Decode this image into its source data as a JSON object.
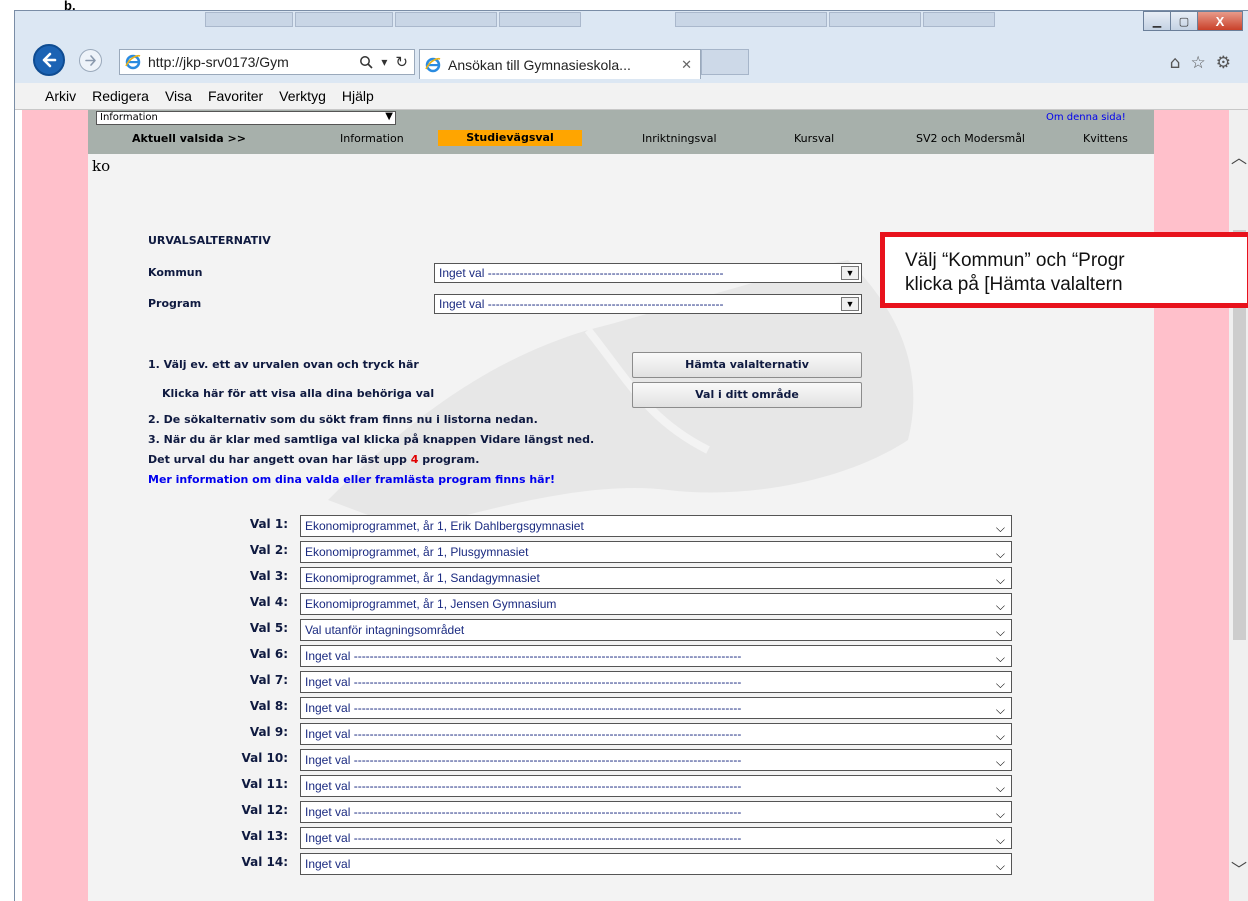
{
  "heading": {
    "text": "b."
  },
  "browser": {
    "address": "http://jkp-srv0173/Gym",
    "tab_title": "Ansökan till Gymnasieskola...",
    "tab_close": "✕",
    "window_buttons": {
      "minimize": "▁",
      "maximize": "▢",
      "close": "X"
    }
  },
  "menubar": [
    "Arkiv",
    "Redigera",
    "Visa",
    "Favoriter",
    "Verktyg",
    "Hjälp"
  ],
  "page": {
    "info_select": "Information",
    "about_link": "Om denna sida!",
    "steps": {
      "current_label": "Aktuell valsida >>",
      "information": "Information",
      "studievagsval": "Studievägsval",
      "inriktningsval": "Inriktningsval",
      "kursval": "Kursval",
      "sv2": "SV2 och Modersmål",
      "kvittens": "Kvittens"
    },
    "stray_text": "ko",
    "form": {
      "heading": "URVALSALTERNATIV",
      "kommun_label": "Kommun",
      "kommun_value": "Inget val -----------------------------------------------------------",
      "program_label": "Program",
      "program_value": "Inget val -----------------------------------------------------------"
    },
    "instructions": {
      "step1": "1. Välj ev. ett av urvalen ovan och tryck här",
      "show_all": "Klicka här för att visa alla dina behöriga val",
      "step2": "2. De sökalternativ som du sökt fram finns nu i listorna nedan.",
      "step3": "3. När du är klar med samtliga val klicka på knappen Vidare längst ned.",
      "result_prefix": "Det urval du har angett ovan har läst upp",
      "result_count": "4",
      "result_suffix": "program.",
      "more_info_link": "Mer information om dina valda eller framlästa program finns här!"
    },
    "buttons": {
      "fetch": "Hämta valalternativ",
      "area": "Val i ditt område"
    },
    "choices": [
      {
        "label": "Val 1:",
        "value": "Ekonomiprogrammet, år 1, Erik Dahlbergsgymnasiet"
      },
      {
        "label": "Val 2:",
        "value": "Ekonomiprogrammet, år 1, Plusgymnasiet"
      },
      {
        "label": "Val 3:",
        "value": "Ekonomiprogrammet, år 1, Sandagymnasiet"
      },
      {
        "label": "Val 4:",
        "value": "Ekonomiprogrammet, år 1, Jensen Gymnasium"
      },
      {
        "label": "Val 5:",
        "value": "Val utanför intagningsområdet"
      },
      {
        "label": "Val 6:",
        "value": "Inget val -------------------------------------------------------------------------------------------------"
      },
      {
        "label": "Val 7:",
        "value": "Inget val -------------------------------------------------------------------------------------------------"
      },
      {
        "label": "Val 8:",
        "value": "Inget val -------------------------------------------------------------------------------------------------"
      },
      {
        "label": "Val 9:",
        "value": "Inget val -------------------------------------------------------------------------------------------------"
      },
      {
        "label": "Val 10:",
        "value": "Inget val -------------------------------------------------------------------------------------------------"
      },
      {
        "label": "Val 11:",
        "value": "Inget val -------------------------------------------------------------------------------------------------"
      },
      {
        "label": "Val 12:",
        "value": "Inget val -------------------------------------------------------------------------------------------------"
      },
      {
        "label": "Val 13:",
        "value": "Inget val -------------------------------------------------------------------------------------------------"
      },
      {
        "label": "Val 14:",
        "value": "Inget val"
      }
    ]
  },
  "callout": {
    "line1": "Välj “Kommun” och “Progr",
    "line2": "klicka på [Hämta valaltern",
    "border_color": "#e8121c"
  }
}
